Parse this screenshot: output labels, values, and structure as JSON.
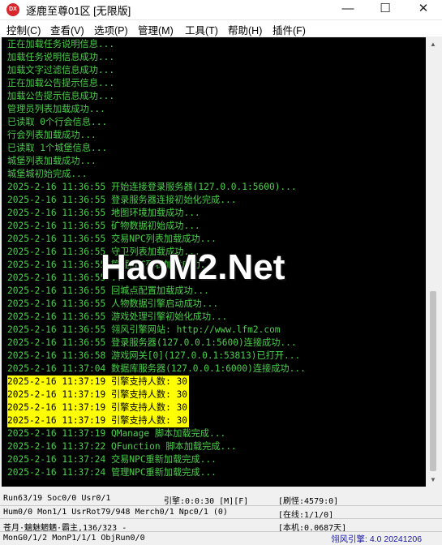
{
  "window": {
    "icon_label": "DX",
    "title": "逐鹿至尊01区 [无限版]",
    "minimize": "—",
    "maximize": "☐",
    "close": "✕"
  },
  "menu": [
    "控制(C)",
    "查看(V)",
    "选项(P)",
    "管理(M)",
    "工具(T)",
    "帮助(H)",
    "插件(F)"
  ],
  "log_lines": [
    {
      "text": "正在加载任务说明信息...",
      "highlight": false
    },
    {
      "text": "加载任务说明信息成功...",
      "highlight": false
    },
    {
      "text": "加载文字过滤信息成功...",
      "highlight": false
    },
    {
      "text": "正在加载公告提示信息...",
      "highlight": false
    },
    {
      "text": "加载公告提示信息成功...",
      "highlight": false
    },
    {
      "text": "管理员列表加载成功...",
      "highlight": false
    },
    {
      "text": "已读取 0个行会信息...",
      "highlight": false
    },
    {
      "text": "行会列表加载成功...",
      "highlight": false
    },
    {
      "text": "已读取 1个城堡信息...",
      "highlight": false
    },
    {
      "text": "城堡列表加载成功...",
      "highlight": false
    },
    {
      "text": "城堡城初始完成...",
      "highlight": false
    },
    {
      "text": "2025-2-16 11:36:55 开始连接登录服务器(127.0.0.1:5600)...",
      "highlight": false
    },
    {
      "text": "2025-2-16 11:36:55 登录服务器连接初始化完成...",
      "highlight": false
    },
    {
      "text": "2025-2-16 11:36:55 地图环境加载成功...",
      "highlight": false
    },
    {
      "text": "2025-2-16 11:36:55 矿物数据初始成功...",
      "highlight": false
    },
    {
      "text": "2025-2-16 11:36:55 交易NPC列表加载成功...",
      "highlight": false
    },
    {
      "text": "2025-2-16 11:36:55 守卫列表加载成功...",
      "highlight": false
    },
    {
      "text": "2025-2-16 11:36:55 管理NPC列表加载成功...",
      "highlight": false
    },
    {
      "text": "2025-2-16 11:36:55 ...",
      "highlight": false
    },
    {
      "text": "2025-2-16 11:36:55 回城点配置加载成功...",
      "highlight": false
    },
    {
      "text": "2025-2-16 11:36:55 人物数据引擎启动成功...",
      "highlight": false
    },
    {
      "text": "2025-2-16 11:36:55 游戏处理引擎初始化成功...",
      "highlight": false
    },
    {
      "text": "2025-2-16 11:36:55 翎风引擎网站: http://www.lfm2.com",
      "highlight": false
    },
    {
      "text": "2025-2-16 11:36:55 登录服务器(127.0.0.1:5600)连接成功...",
      "highlight": false
    },
    {
      "text": "2025-2-16 11:36:58 游戏网关[0](127.0.0.1:53813)已打开...",
      "highlight": false
    },
    {
      "text": "2025-2-16 11:37:04 数据库服务器(127.0.0.1:6000)连接成功...",
      "highlight": false
    },
    {
      "text": "2025-2-16 11:37:19 引擎支持人数: 30",
      "highlight": true
    },
    {
      "text": "2025-2-16 11:37:19 引擎支持人数: 30",
      "highlight": true
    },
    {
      "text": "2025-2-16 11:37:19 引擎支持人数: 30",
      "highlight": true
    },
    {
      "text": "2025-2-16 11:37:19 引擎支持人数: 30",
      "highlight": true
    },
    {
      "text": "2025-2-16 11:37:19 QManage 脚本加载完成...",
      "highlight": false
    },
    {
      "text": "2025-2-16 11:37:22 QFunction 脚本加载完成...",
      "highlight": false
    },
    {
      "text": "2025-2-16 11:37:24 交易NPC重新加载完成...",
      "highlight": false
    },
    {
      "text": "2025-2-16 11:37:24 管理NPC重新加载完成...",
      "highlight": false
    }
  ],
  "watermark": "HaoM2.Net",
  "status": {
    "run": "Run63/19 Soc0/0 Usr0/1",
    "engine": "引擎:0:0:30 [M][F]",
    "refresh": "[刷怪:4579:0]",
    "hum": "Hum0/0 Mon1/1 UsrRot79/948 Merch0/1 Npc0/1 (0)",
    "online": "[在线:1/1/0]",
    "player": "苍月·魑魅魍魉·霸主,136/323 -",
    "local": "[本机:0.0687天]",
    "mongo": "MonG0/1/2 MonP1/1/1 ObjRun0/0",
    "version": "翎风引擎: 4.0 20241206"
  },
  "colors": {
    "console_bg": "#000000",
    "log_text": "#4ad04a",
    "highlight_bg": "#ffff00",
    "version_text": "#1a1aa8"
  }
}
